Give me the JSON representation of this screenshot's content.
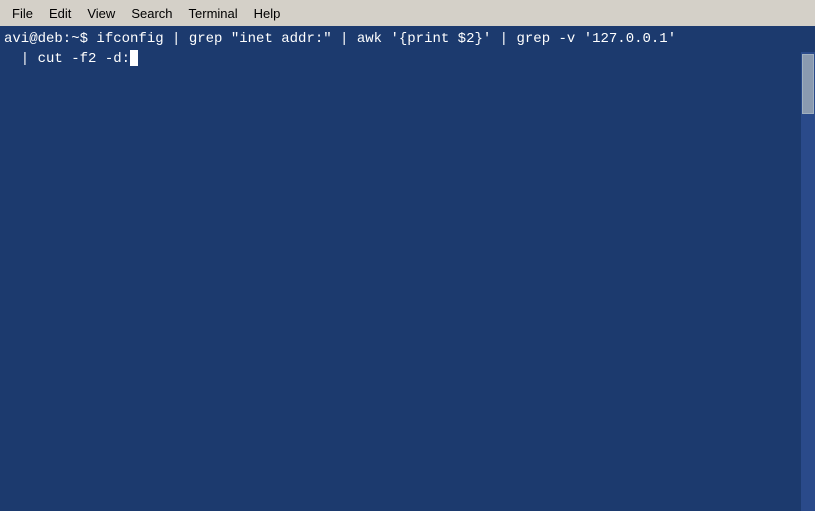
{
  "menubar": {
    "items": [
      {
        "label": "File",
        "name": "menu-file"
      },
      {
        "label": "Edit",
        "name": "menu-edit"
      },
      {
        "label": "View",
        "name": "menu-view"
      },
      {
        "label": "Search",
        "name": "menu-search"
      },
      {
        "label": "Terminal",
        "name": "menu-terminal"
      },
      {
        "label": "Help",
        "name": "menu-help"
      }
    ]
  },
  "terminal": {
    "prompt": "avi@deb:~$",
    "command_line1": " ifconfig | grep \"inet addr:\" | awk '{print $2}' | grep -v '127.0.0.1'",
    "command_line2": "  | cut -f2 -d:",
    "bg_color": "#1c3a6e"
  }
}
